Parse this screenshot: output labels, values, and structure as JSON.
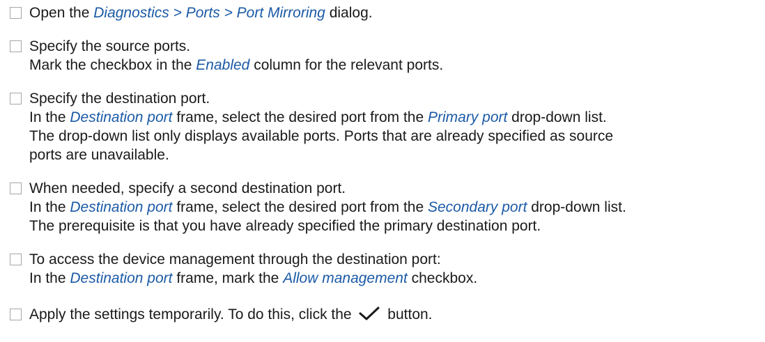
{
  "steps": [
    {
      "l1": {
        "a": "Open the ",
        "b": "Diagnostics > Ports > Port Mirroring",
        "c": " dialog."
      }
    },
    {
      "l1": "Specify the source ports.",
      "l2": {
        "a": "Mark the checkbox in the ",
        "b": "Enabled",
        "c": " column for the relevant ports."
      }
    },
    {
      "l1": "Specify the destination port.",
      "l2": {
        "a": "In the ",
        "b": "Destination port",
        "c": " frame, select the desired port from the ",
        "d": "Primary port",
        "e": " drop-down list."
      },
      "l3": "The drop-down list only displays available ports. Ports that are already specified as source",
      "l4": "ports are unavailable."
    },
    {
      "l1": "When needed, specify a second destination port.",
      "l2": {
        "a": "In the ",
        "b": "Destination port",
        "c": " frame, select the desired port from the ",
        "d": "Secondary port",
        "e": " drop-down list."
      },
      "l3": "The prerequisite is that you have already specified the primary destination port."
    },
    {
      "l1": "To access the device management through the destination port:",
      "l2": {
        "a": "In the ",
        "b": "Destination port",
        "c": " frame, mark the ",
        "d": "Allow management",
        "e": " checkbox."
      }
    },
    {
      "l1": {
        "a": "Apply the settings temporarily. To do this, click the ",
        "b": " button."
      }
    }
  ],
  "icons": {
    "apply_icon": "checkmark-icon"
  },
  "colors": {
    "text": "#1a1a1a",
    "reference": "#1b5aa6",
    "checkbox_border": "#a6a6a6"
  }
}
